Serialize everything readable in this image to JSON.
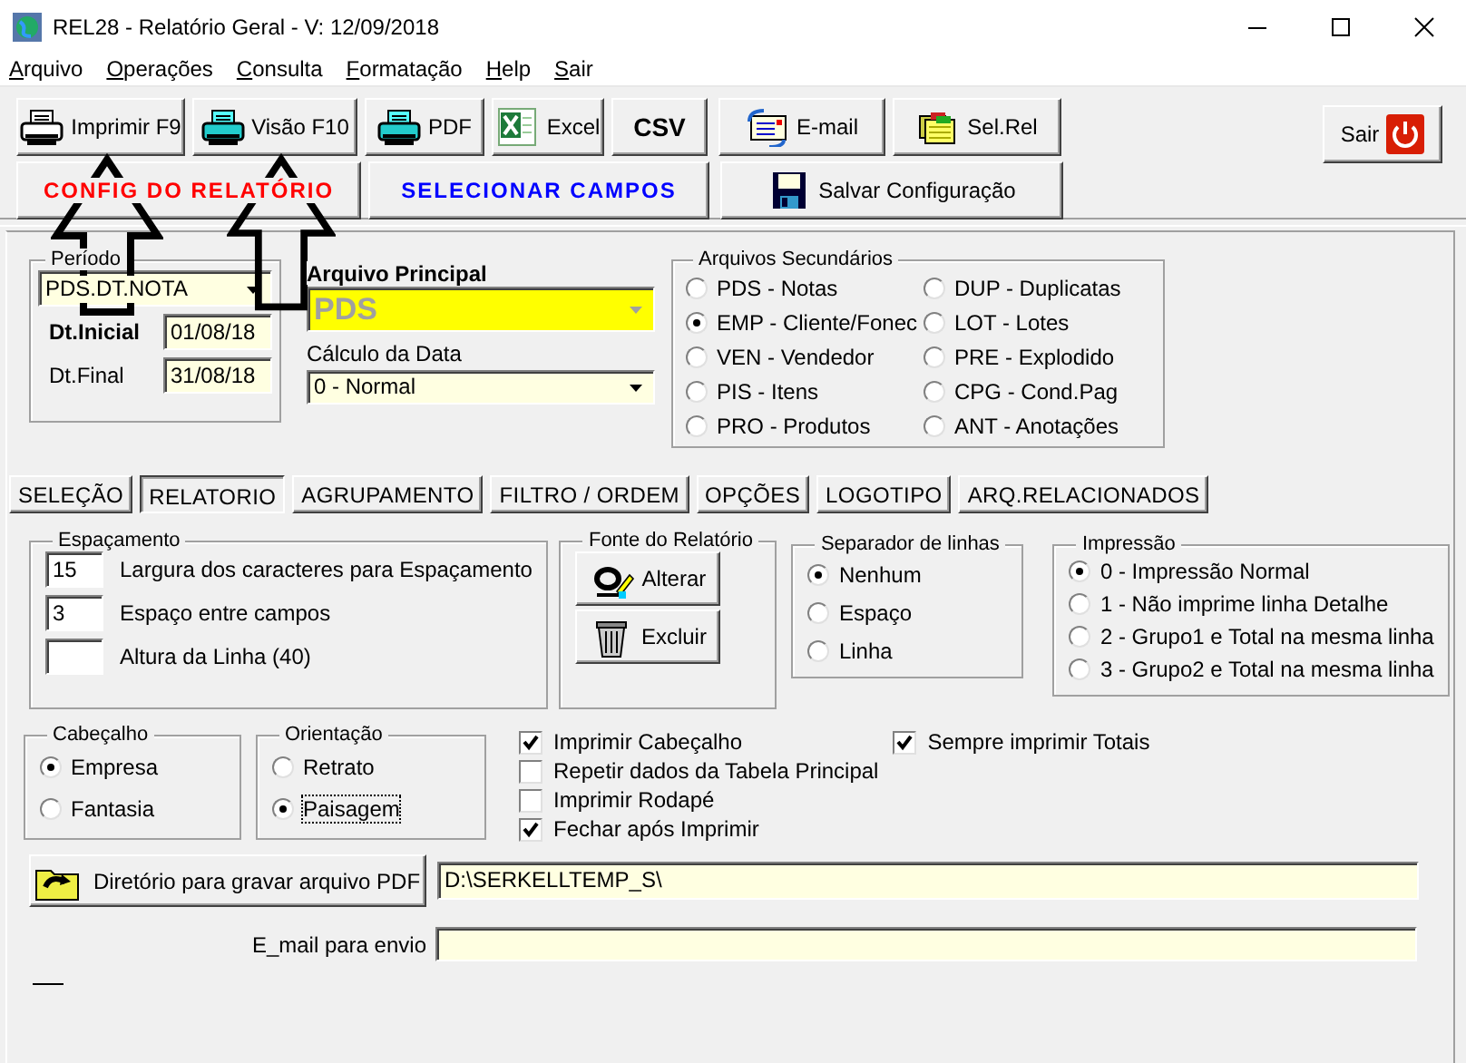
{
  "window": {
    "title": "REL28 - Relatório Geral - V: 12/09/2018"
  },
  "menu": [
    {
      "label": "Arquivo"
    },
    {
      "label": "Operações"
    },
    {
      "label": "Consulta"
    },
    {
      "label": "Formatação"
    },
    {
      "label": "Help"
    },
    {
      "label": "Sair"
    }
  ],
  "toolbar": [
    {
      "kind": "printer",
      "label": "Imprimir F9"
    },
    {
      "kind": "preview",
      "label": "Visão F10"
    },
    {
      "kind": "pdf",
      "label": "PDF"
    },
    {
      "kind": "excel",
      "label": "Excel"
    },
    {
      "kind": "text",
      "label": "CSV"
    },
    {
      "kind": "mail",
      "label": "E-mail"
    },
    {
      "kind": "folders",
      "label": "Sel.Rel"
    }
  ],
  "toolbar_row2": [
    {
      "kind": "text",
      "label": "CONFIG DO RELATÓRIO",
      "color": "#ff0000"
    },
    {
      "kind": "text",
      "label": "SELECIONAR CAMPOS",
      "color": "#0000ff"
    },
    {
      "kind": "floppy",
      "label": "Salvar Configuração",
      "color": "#000000"
    }
  ],
  "exit_button": {
    "label": "Sair"
  },
  "periodo": {
    "legend": "Período",
    "combo": "PDS.DT.NOTA",
    "start": {
      "label": "Dt.Inicial",
      "value": "01/08/18"
    },
    "end": {
      "label": "Dt.Final",
      "value": "31/08/18"
    }
  },
  "arquivo_principal": {
    "label": "Arquivo Principal",
    "value": "PDS",
    "disabled": true
  },
  "calculo_data": {
    "label": "Cálculo da Data",
    "value": "0 - Normal"
  },
  "arquivos_secundarios": {
    "legend": "Arquivos Secundários",
    "options": [
      {
        "label": "PDS - Notas",
        "selected": false
      },
      {
        "label": "EMP - Cliente/Fonec",
        "selected": true
      },
      {
        "label": "VEN - Vendedor",
        "selected": false
      },
      {
        "label": "PIS - Itens",
        "selected": false
      },
      {
        "label": "PRO - Produtos",
        "selected": false
      },
      {
        "label": "DUP - Duplicatas",
        "selected": false
      },
      {
        "label": "LOT - Lotes",
        "selected": false
      },
      {
        "label": "PRE - Explodido",
        "selected": false
      },
      {
        "label": "CPG - Cond.Pag",
        "selected": false
      },
      {
        "label": "ANT - Anotações",
        "selected": false
      }
    ]
  },
  "tabs": [
    {
      "label": "SELEÇÃO",
      "selected": false
    },
    {
      "label": "RELATORIO",
      "selected": true
    },
    {
      "label": "AGRUPAMENTO",
      "selected": false
    },
    {
      "label": "FILTRO / ORDEM",
      "selected": false
    },
    {
      "label": "OPÇÕES",
      "selected": false
    },
    {
      "label": "LOGOTIPO",
      "selected": false
    },
    {
      "label": "ARQ.RELACIONADOS",
      "selected": false
    }
  ],
  "espacamento": {
    "legend": "Espaçamento",
    "fields": [
      {
        "value": "15",
        "label": "Largura dos caracteres para Espaçamento"
      },
      {
        "value": "3",
        "label": "Espaço entre campos"
      },
      {
        "label": "Altura da Linha (40)"
      }
    ]
  },
  "fonte": {
    "legend": "Fonte do Relatório",
    "buttons": [
      {
        "kind": "font",
        "label": "Alterar"
      },
      {
        "kind": "trash",
        "label": "Excluir"
      }
    ]
  },
  "separador": {
    "legend": "Separador de linhas",
    "options": [
      {
        "label": "Nenhum",
        "selected": true
      },
      {
        "label": "Espaço",
        "selected": false
      },
      {
        "label": "Linha",
        "selected": false
      }
    ]
  },
  "impressao": {
    "legend": "Impressão",
    "options": [
      {
        "label": "0 - Impressão Normal",
        "selected": true
      },
      {
        "label": "1 - Não imprime linha Detalhe",
        "selected": false
      },
      {
        "label": "2 - Grupo1 e Total na mesma linha",
        "selected": false
      },
      {
        "label": "3 - Grupo2 e Total na mesma linha",
        "selected": false
      }
    ]
  },
  "cabecalho": {
    "legend": "Cabeçalho",
    "options": [
      {
        "label": "Empresa",
        "selected": true
      },
      {
        "label": "Fantasia",
        "selected": false
      }
    ]
  },
  "orientacao": {
    "legend": "Orientação",
    "options": [
      {
        "label": "Retrato",
        "selected": false,
        "focused": false
      },
      {
        "label": "Paisagem",
        "selected": true,
        "focused": true
      }
    ]
  },
  "checkboxes": [
    {
      "label": "Imprimir Cabeçalho",
      "checked": true
    },
    {
      "label": "Repetir dados da Tabela Principal",
      "checked": false
    },
    {
      "label": "Imprimir Rodapé",
      "checked": false
    },
    {
      "label": "Fechar após Imprimir",
      "checked": true
    }
  ],
  "totals_checkbox": {
    "label": "Sempre imprimir Totais",
    "checked": true
  },
  "pdf_directory": {
    "button": "Diretório para gravar arquivo PDF",
    "value": "D:\\SERKELLTEMP_S\\"
  },
  "email": {
    "label": "E_mail para envio"
  }
}
